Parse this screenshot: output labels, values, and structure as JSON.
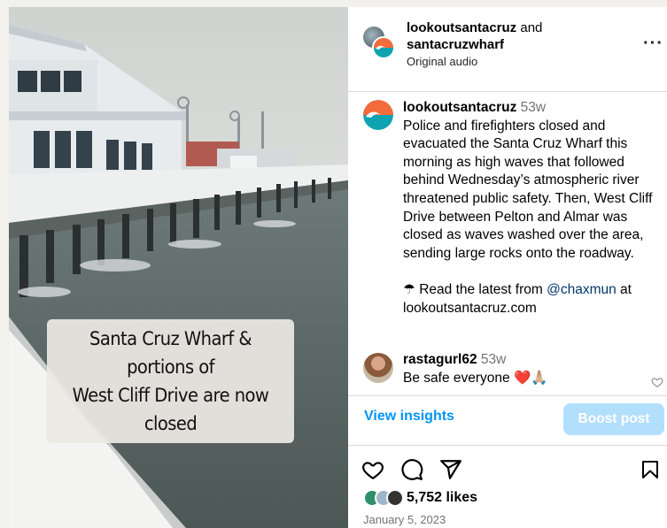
{
  "post": {
    "author": "lookoutsantacruz",
    "connector": "and",
    "collaborator": "santacruzwharf",
    "audio": "Original audio",
    "media_caption_line1": "Santa Cruz Wharf & portions of",
    "media_caption_line2": "West Cliff Drive are now closed"
  },
  "caption": {
    "username": "lookoutsantacruz",
    "age": "53w",
    "text": "Police and firefighters closed and evacuated the Santa Cruz Wharf this morning as high waves that followed behind Wednesday’s atmospheric river threatened public safety. Then, West Cliff Drive between Pelton and Almar was closed as waves washed over the area, sending large rocks onto the roadway.",
    "read_prefix": "☂ Read the latest from",
    "mention": "@chaxmun",
    "read_suffix": "at lookoutsantacruz.com"
  },
  "reply": {
    "username": "rastagurl62",
    "age": "53w",
    "text": "Be safe everyone",
    "emoji": "❤️🙏🏼"
  },
  "insights": {
    "view_label": "View insights",
    "boost_label": "Boost post"
  },
  "engagement": {
    "likes": "5,752 likes",
    "date": "January 5, 2023"
  },
  "icons": {
    "like": "heart-icon",
    "comment": "comment-icon",
    "share": "send-icon",
    "save": "bookmark-icon",
    "more": "more-icon"
  },
  "colors": {
    "accent": "#0095f6",
    "boost_disabled": "#b2dffc",
    "link": "#00376b",
    "muted": "#737373"
  }
}
